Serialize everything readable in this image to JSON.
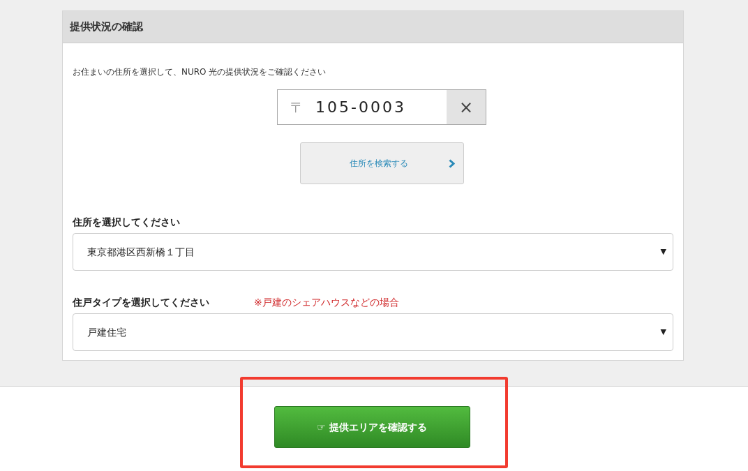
{
  "panel": {
    "title": "提供状況の確認",
    "instruction": "お住まいの住所を選択して、NURO 光の提供状況をご確認ください",
    "postal": {
      "mark": "〒",
      "value": "105-0003",
      "clear": "×"
    },
    "search_button": "住所を検索する",
    "fields": [
      {
        "label": "住所を選択してください",
        "value": "東京都港区西新橋１丁目",
        "arrow": "▼"
      },
      {
        "label": "住戸タイプを選択してください",
        "note": "※戸建のシェアハウスなどの場合",
        "value": "戸建住宅",
        "arrow": "▼"
      }
    ]
  },
  "confirm_button": "☞ 提供エリアを確認する"
}
